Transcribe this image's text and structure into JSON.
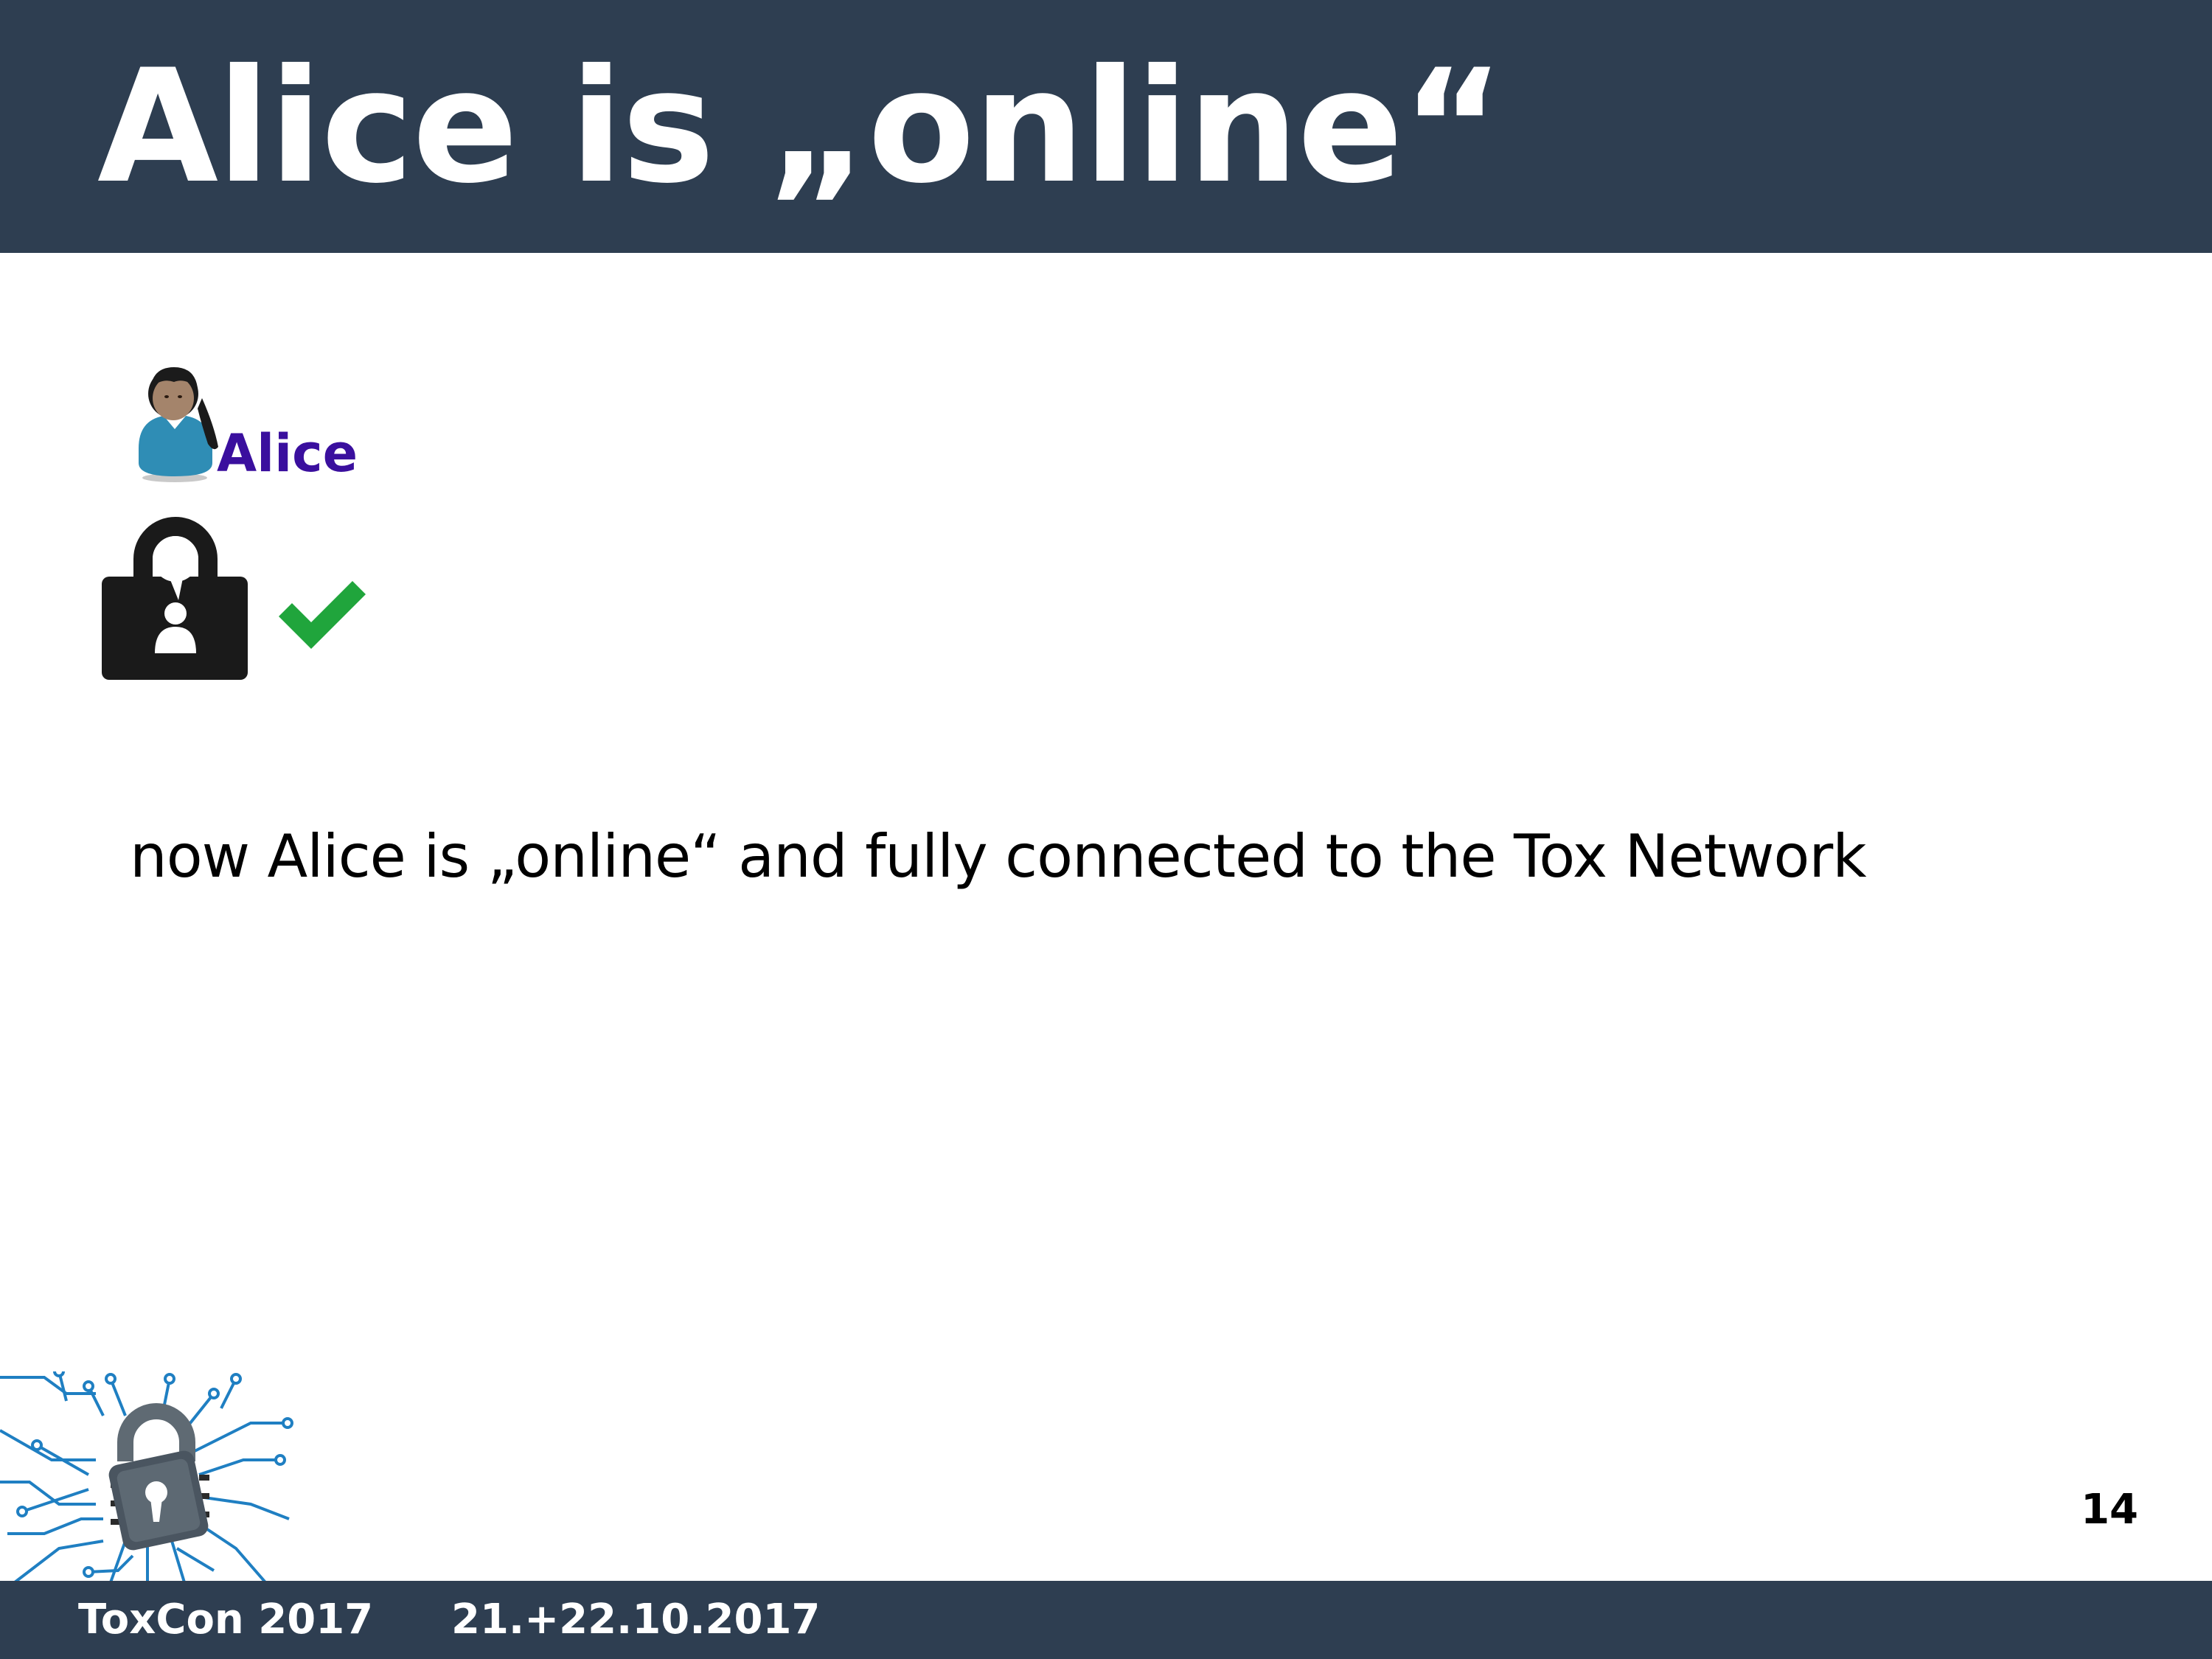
{
  "slide": {
    "title": "Alice is „online“",
    "user_label": "Alice",
    "body_text": "now Alice is „online“ and fully connected to the Tox Network",
    "page_number": "14"
  },
  "footer": {
    "event": "ToxCon 2017",
    "date": "21.+22.10.2017"
  },
  "icons": {
    "avatar": "user-avatar-icon",
    "tox_logo": "tox-lock-icon",
    "status": "checkmark-icon",
    "conference_logo": "circuit-padlock-logo"
  },
  "colors": {
    "header_bg": "#2e3e51",
    "footer_bg": "#2e3e51",
    "user_label": "#3a0f9e",
    "check": "#20a53c",
    "circuit": "#1f7fc2"
  }
}
